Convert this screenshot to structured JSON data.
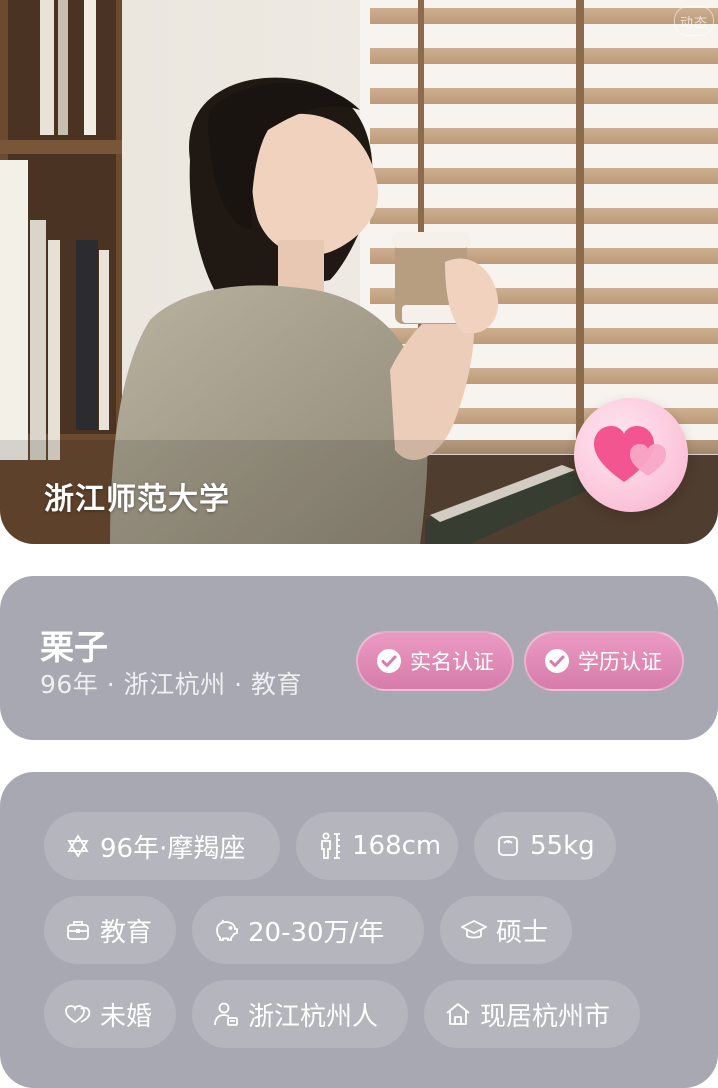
{
  "photo": {
    "school": "浙江师范大学",
    "corner_badge": "动态"
  },
  "profile": {
    "name": "栗子",
    "meta": "96年 · 浙江杭州 · 教育",
    "badges": [
      "实名认证",
      "学历认证"
    ]
  },
  "tags": [
    {
      "icon": "star-of-david-icon",
      "label": "96年·摩羯座"
    },
    {
      "icon": "height-icon",
      "label": "168cm"
    },
    {
      "icon": "scale-icon",
      "label": "55kg"
    },
    {
      "icon": "briefcase-icon",
      "label": "教育"
    },
    {
      "icon": "piggy-bank-icon",
      "label": "20-30万/年"
    },
    {
      "icon": "graduation-cap-icon",
      "label": "硕士"
    },
    {
      "icon": "hearts-icon",
      "label": "未婚"
    },
    {
      "icon": "person-id-icon",
      "label": "浙江杭州人"
    },
    {
      "icon": "home-icon",
      "label": "现居杭州市"
    }
  ],
  "colors": {
    "card_bg": "#a7a8b1",
    "badge_pink": "#e08cb8",
    "heart_pink": "#f2558f"
  }
}
